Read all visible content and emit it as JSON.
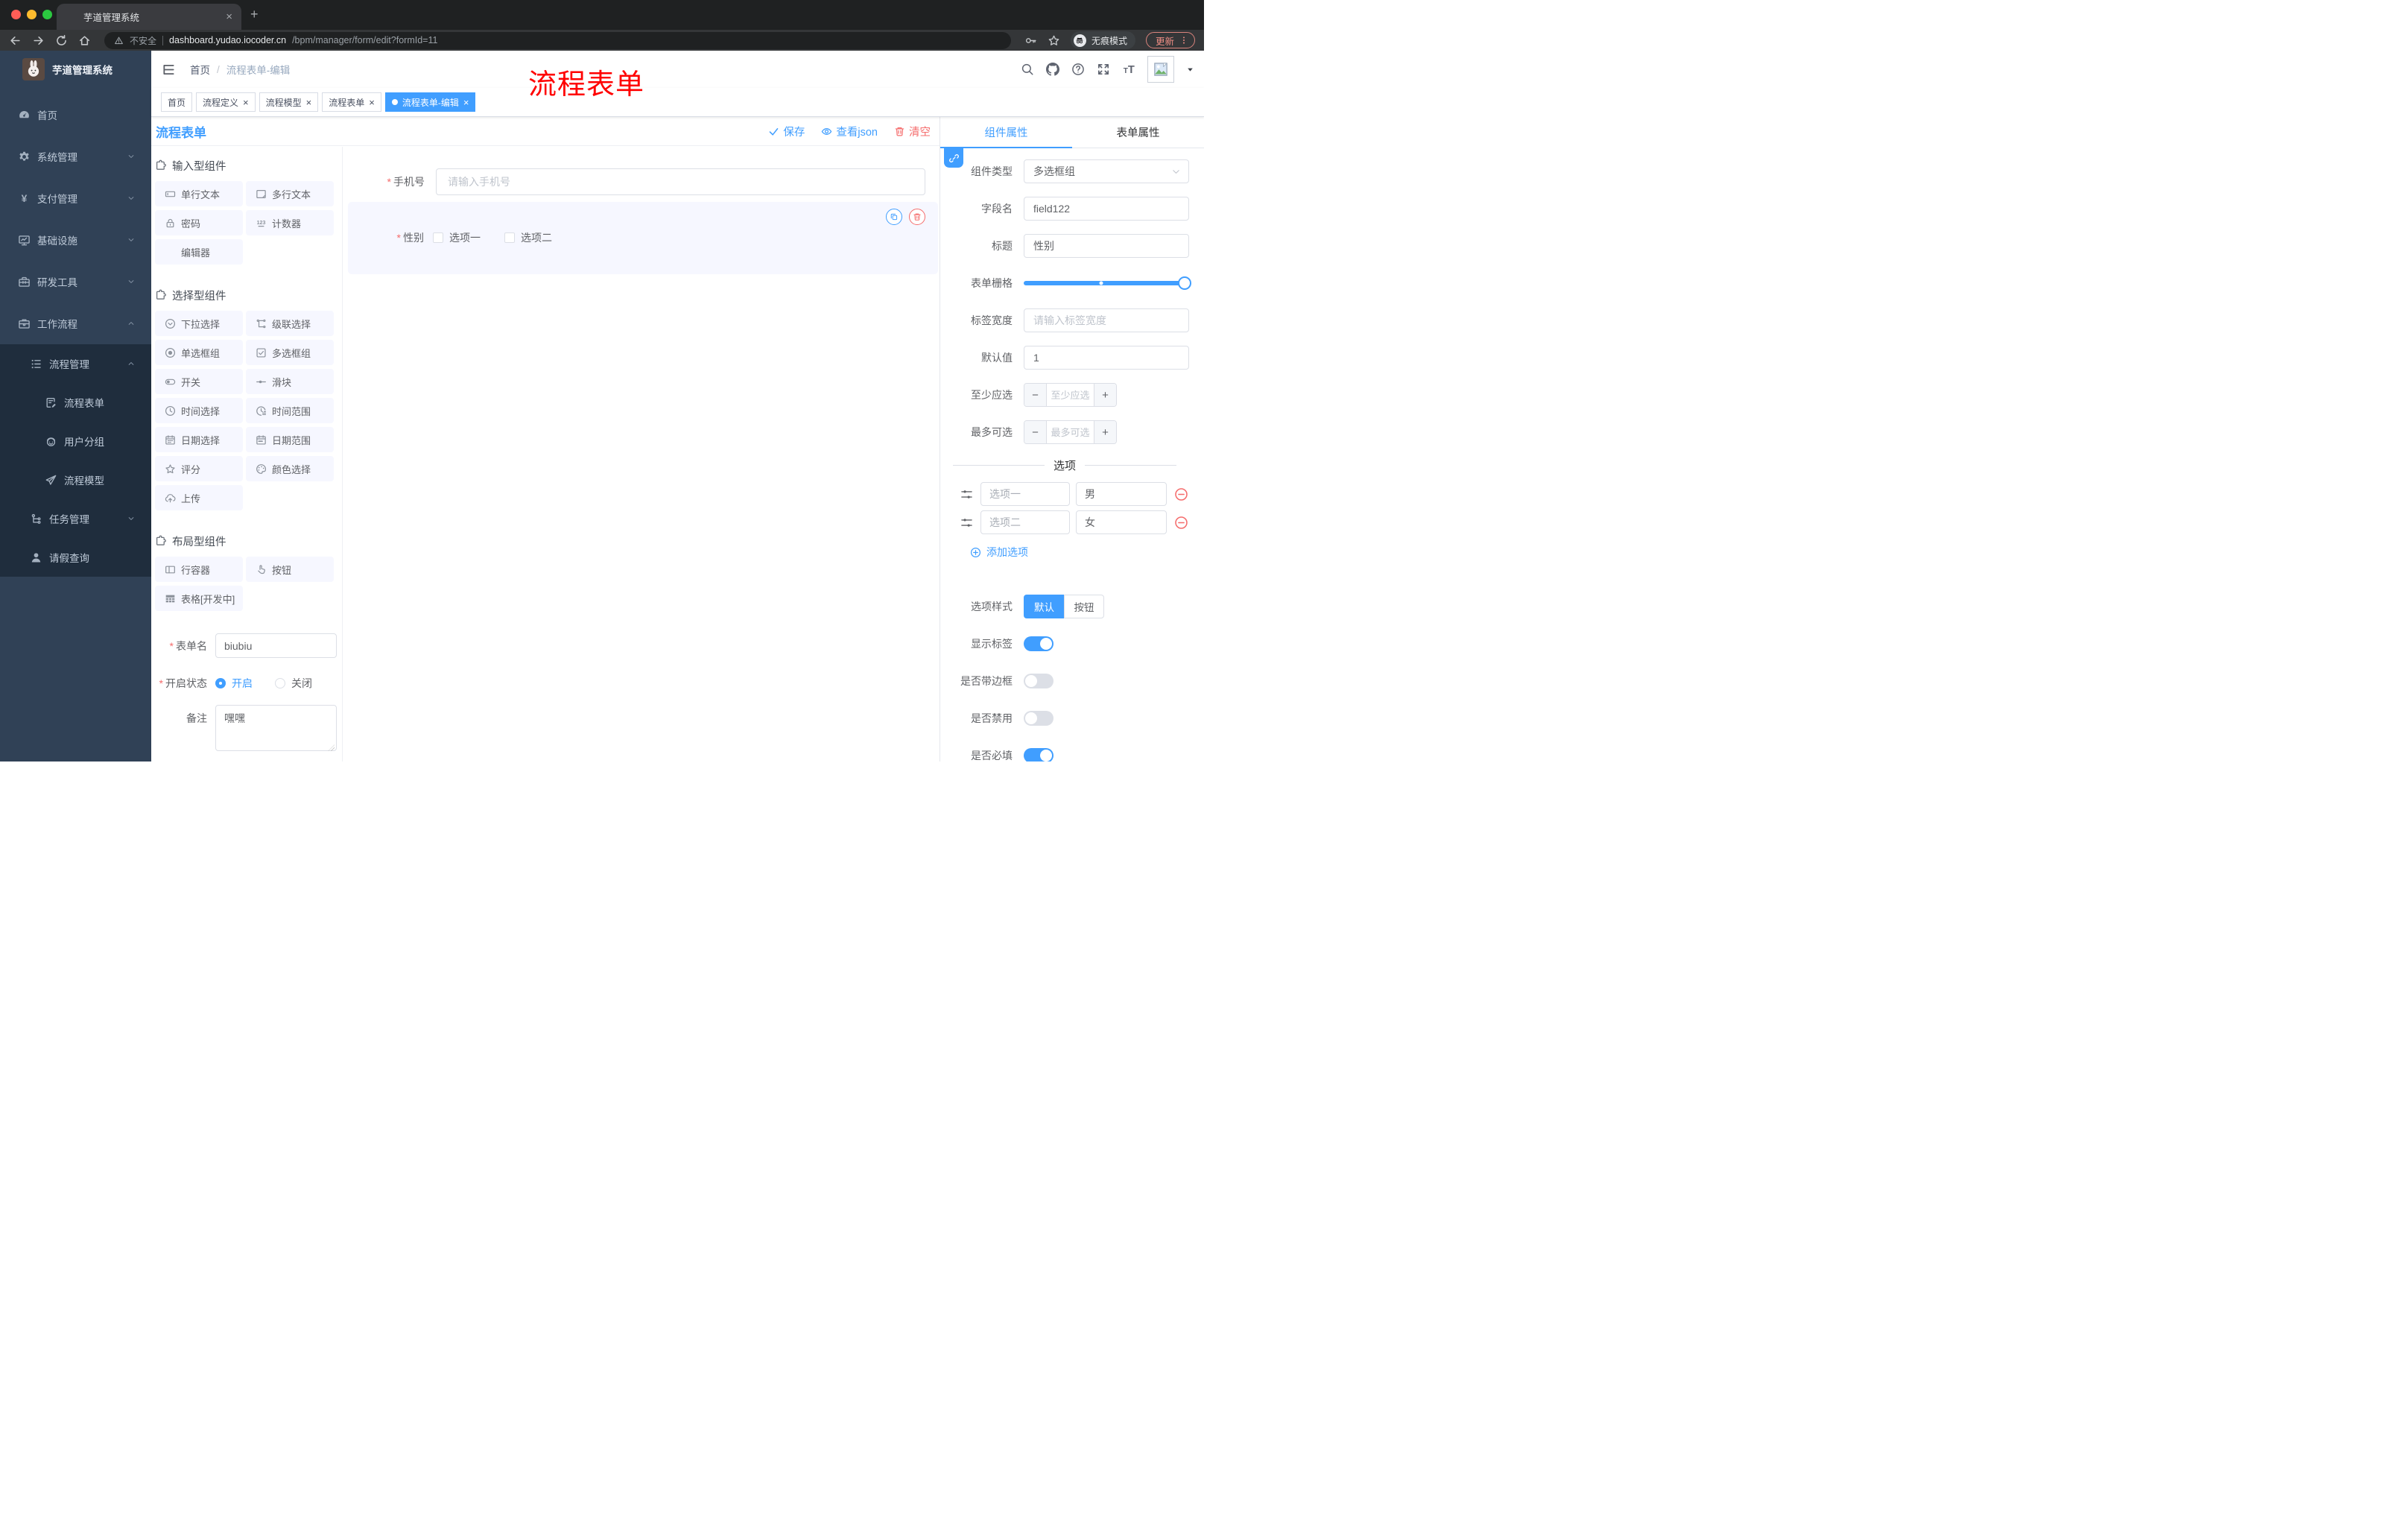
{
  "colors": {
    "accent": "#409EFF",
    "danger": "#F56C6C",
    "annotation_red": "#FF0000",
    "sidebar_bg": "#304156",
    "submenu_bg": "#1F2D3D"
  },
  "browser": {
    "tab": {
      "title": "芋道管理系统"
    },
    "new_tab": "+",
    "security_label": "不安全",
    "url_host": "dashboard.yudao.iocoder.cn",
    "url_path": "/bpm/manager/form/edit?formId=11",
    "incognito_label": "无痕模式",
    "update_label": "更新"
  },
  "sidebar": {
    "logo_title": "芋道管理系统",
    "menu": [
      {
        "label": "首页",
        "icon": "dashboard-icon",
        "level": 0
      },
      {
        "label": "系统管理",
        "icon": "gear-icon",
        "level": 0,
        "arrow": "down"
      },
      {
        "label": "支付管理",
        "icon": "yen-icon",
        "level": 0,
        "arrow": "down"
      },
      {
        "label": "基础设施",
        "icon": "monitor-icon",
        "level": 0,
        "arrow": "down"
      },
      {
        "label": "研发工具",
        "icon": "toolbox-icon",
        "level": 0,
        "arrow": "down"
      },
      {
        "label": "工作流程",
        "icon": "briefcase-icon",
        "level": 0,
        "arrow": "up"
      },
      {
        "label": "流程管理",
        "icon": "list-icon",
        "level": 1,
        "arrow": "up",
        "submenu": true
      },
      {
        "label": "流程表单",
        "icon": "form-icon",
        "level": 2,
        "submenu": true
      },
      {
        "label": "用户分组",
        "icon": "group-icon",
        "level": 2,
        "submenu": true
      },
      {
        "label": "流程模型",
        "icon": "send-icon",
        "level": 2,
        "submenu": true
      },
      {
        "label": "任务管理",
        "icon": "tree-icon",
        "level": 1,
        "arrow": "down",
        "submenu": true
      },
      {
        "label": "请假查询",
        "icon": "user-icon",
        "level": 1,
        "submenu": true
      }
    ]
  },
  "header": {
    "breadcrumb": [
      "首页",
      "流程表单-编辑"
    ],
    "annotation": "流程表单"
  },
  "tags": [
    {
      "label": "首页",
      "closable": false,
      "active": false
    },
    {
      "label": "流程定义",
      "closable": true,
      "active": false
    },
    {
      "label": "流程模型",
      "closable": true,
      "active": false
    },
    {
      "label": "流程表单",
      "closable": true,
      "active": false
    },
    {
      "label": "流程表单-编辑",
      "closable": true,
      "active": true
    }
  ],
  "designer": {
    "title": "流程表单",
    "actions": [
      {
        "label": "保存",
        "icon": "check-icon",
        "color": "#409EFF"
      },
      {
        "label": "查看json",
        "icon": "eye-icon",
        "color": "#409EFF"
      },
      {
        "label": "清空",
        "icon": "trash-icon",
        "color": "#F56C6C"
      }
    ],
    "component_groups": [
      {
        "title": "输入型组件",
        "items": [
          {
            "label": "单行文本",
            "icon": "input-icon"
          },
          {
            "label": "多行文本",
            "icon": "textarea-icon"
          },
          {
            "label": "密码",
            "icon": "lock-icon"
          },
          {
            "label": "计数器",
            "icon": "counter-icon"
          },
          {
            "label": "编辑器",
            "icon": ""
          }
        ]
      },
      {
        "title": "选择型组件",
        "items": [
          {
            "label": "下拉选择",
            "icon": "select-icon"
          },
          {
            "label": "级联选择",
            "icon": "cascader-icon"
          },
          {
            "label": "单选框组",
            "icon": "radio-icon"
          },
          {
            "label": "多选框组",
            "icon": "checkbox-icon"
          },
          {
            "label": "开关",
            "icon": "switch-icon"
          },
          {
            "label": "滑块",
            "icon": "slider-icon"
          },
          {
            "label": "时间选择",
            "icon": "time-icon"
          },
          {
            "label": "时间范围",
            "icon": "time-range-icon"
          },
          {
            "label": "日期选择",
            "icon": "date-icon"
          },
          {
            "label": "日期范围",
            "icon": "date-range-icon"
          },
          {
            "label": "评分",
            "icon": "star-icon"
          },
          {
            "label": "颜色选择",
            "icon": "palette-icon"
          },
          {
            "label": "上传",
            "icon": "upload-icon"
          }
        ]
      },
      {
        "title": "布局型组件",
        "items": [
          {
            "label": "行容器",
            "icon": "row-icon"
          },
          {
            "label": "按钮",
            "icon": "pointer-icon"
          },
          {
            "label": "表格[开发中]",
            "icon": "table-icon"
          }
        ]
      }
    ],
    "meta_form": {
      "form_name_label": "表单名",
      "form_name_value": "biubiu",
      "status_label": "开启状态",
      "status_options": [
        {
          "label": "开启",
          "selected": true
        },
        {
          "label": "关闭",
          "selected": false
        }
      ],
      "remark_label": "备注",
      "remark_value": "嘿嘿"
    },
    "canvas": {
      "phone_field": {
        "label": "手机号",
        "required": true,
        "placeholder": "请输入手机号"
      },
      "gender_field": {
        "label": "性别",
        "required": true,
        "options": [
          "选项一",
          "选项二"
        ]
      }
    }
  },
  "properties": {
    "tabs": [
      {
        "label": "组件属性",
        "active": true
      },
      {
        "label": "表单属性",
        "active": false
      }
    ],
    "component_type_label": "组件类型",
    "component_type_value": "多选框组",
    "field_name_label": "字段名",
    "field_name_value": "field122",
    "title_label": "标题",
    "title_value": "性别",
    "grid_label": "表单栅格",
    "label_width_label": "标签宽度",
    "label_width_placeholder": "请输入标签宽度",
    "default_label": "默认值",
    "default_value": "1",
    "min_label": "至少应选",
    "min_placeholder": "至少应选",
    "max_label": "最多可选",
    "max_placeholder": "最多可选",
    "options_title": "选项",
    "option_rows": [
      {
        "name": "选项一",
        "value": "男"
      },
      {
        "name": "选项二",
        "value": "女"
      }
    ],
    "add_option_label": "添加选项",
    "option_style_label": "选项样式",
    "option_style_options": [
      {
        "label": "默认",
        "active": true
      },
      {
        "label": "按钮",
        "active": false
      }
    ],
    "toggles": [
      {
        "label": "显示标签",
        "on": true
      },
      {
        "label": "是否带边框",
        "on": false
      },
      {
        "label": "是否禁用",
        "on": false
      },
      {
        "label": "是否必填",
        "on": true
      }
    ]
  }
}
